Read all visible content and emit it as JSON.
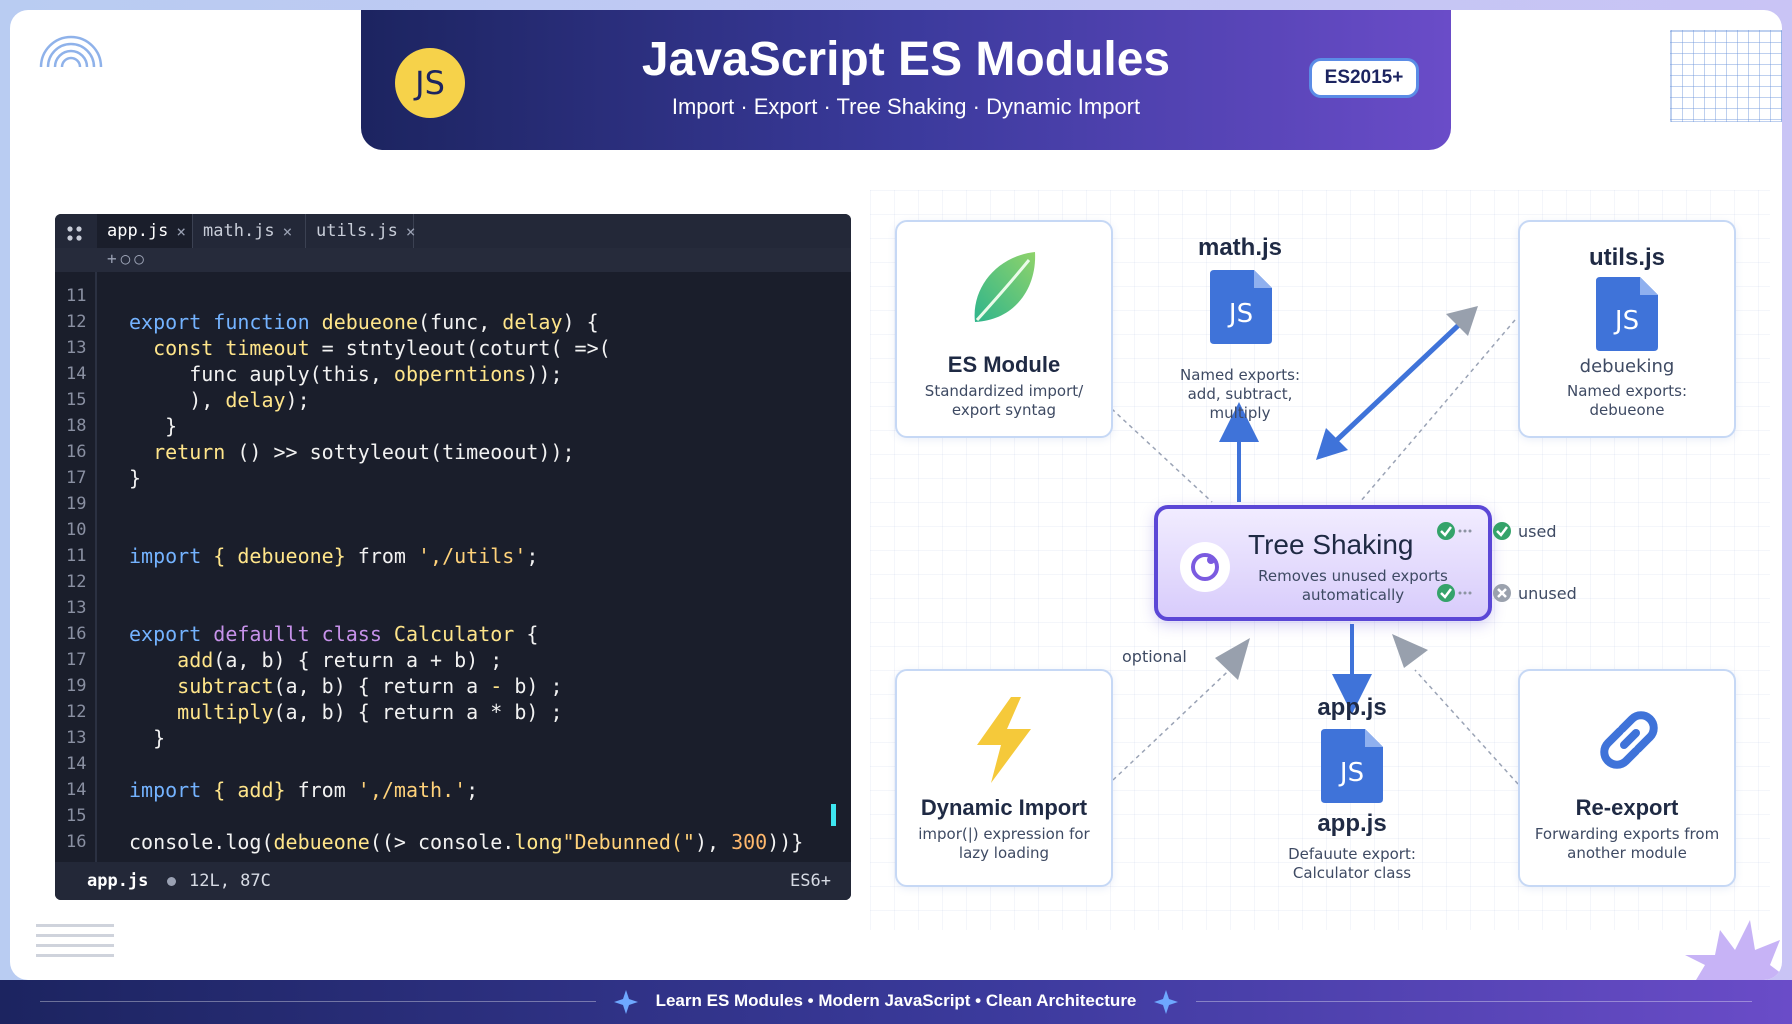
{
  "header": {
    "title": "JavaScript ES Modules",
    "subtitle": "Import · Export · Tree Shaking · Dynamic Import",
    "logo_text": "JS",
    "badge": "ES2015+"
  },
  "editor": {
    "tabs": [
      {
        "label": "app.js",
        "active": true
      },
      {
        "label": "math.js",
        "active": false
      },
      {
        "label": "utils.js",
        "active": false
      }
    ],
    "tab_close": "×",
    "toolbar_icons": "+○○",
    "lines": [
      {
        "n": "11",
        "tokens": []
      },
      {
        "n": "12",
        "tokens": [
          [
            "kw",
            "export "
          ],
          [
            "kw",
            "function "
          ],
          [
            "fn",
            "debueone"
          ],
          [
            "",
            "(func, "
          ],
          [
            "fn",
            "delay"
          ],
          [
            "",
            ") {"
          ]
        ]
      },
      {
        "n": "13",
        "tokens": [
          [
            "",
            "  "
          ],
          [
            "fn",
            "const "
          ],
          [
            "fn",
            "timeout"
          ],
          [
            "",
            " = stntyleout(coturt( =>("
          ]
        ]
      },
      {
        "n": "14",
        "tokens": [
          [
            "",
            "     func auply(this, "
          ],
          [
            "fn",
            "obperntions"
          ],
          [
            "",
            "));"
          ]
        ]
      },
      {
        "n": "15",
        "tokens": [
          [
            "",
            "     ), "
          ],
          [
            "fn",
            "delay"
          ],
          [
            "",
            ");"
          ]
        ]
      },
      {
        "n": "18",
        "tokens": [
          [
            "",
            "   }"
          ]
        ]
      },
      {
        "n": "16",
        "tokens": [
          [
            "",
            "  "
          ],
          [
            "fn",
            "return"
          ],
          [
            "",
            " () >> sottyleout(timeoout));"
          ]
        ]
      },
      {
        "n": "17",
        "tokens": [
          [
            "",
            "}"
          ]
        ]
      },
      {
        "n": "19",
        "tokens": []
      },
      {
        "n": "10",
        "tokens": []
      },
      {
        "n": "11",
        "tokens": [
          [
            "kw",
            "import "
          ],
          [
            "fn",
            "{ debueone}"
          ],
          [
            "",
            " from "
          ],
          [
            "str",
            "',/utils'"
          ],
          [
            "",
            ";"
          ]
        ]
      },
      {
        "n": "12",
        "tokens": []
      },
      {
        "n": "13",
        "tokens": []
      },
      {
        "n": "16",
        "tokens": [
          [
            "kw",
            "export "
          ],
          [
            "kw2",
            "defaullt "
          ],
          [
            "kw2",
            "class "
          ],
          [
            "fn",
            "Calculator"
          ],
          [
            "",
            " {"
          ]
        ]
      },
      {
        "n": "17",
        "tokens": [
          [
            "",
            "    "
          ],
          [
            "fn",
            "add"
          ],
          [
            "",
            "(a, b) { return a + b) ;"
          ]
        ]
      },
      {
        "n": "19",
        "tokens": [
          [
            "",
            "    "
          ],
          [
            "fn",
            "subtract"
          ],
          [
            "",
            "(a, b) { return a "
          ],
          [
            "fn",
            "-"
          ],
          [
            "",
            " b) ;"
          ]
        ]
      },
      {
        "n": "12",
        "tokens": [
          [
            "",
            "    "
          ],
          [
            "fn",
            "multiply"
          ],
          [
            "",
            "(a, b) { return a * b) ;"
          ]
        ]
      },
      {
        "n": "13",
        "tokens": [
          [
            "",
            "  }"
          ]
        ]
      },
      {
        "n": "14",
        "tokens": []
      },
      {
        "n": "14",
        "tokens": [
          [
            "kw",
            "import "
          ],
          [
            "fn",
            "{ add}"
          ],
          [
            "",
            " from "
          ],
          [
            "str",
            "',/math.'"
          ],
          [
            "",
            ";"
          ]
        ]
      },
      {
        "n": "15",
        "tokens": []
      },
      {
        "n": "16",
        "tokens": [
          [
            "",
            "console.log("
          ],
          [
            "fn",
            "debueone"
          ],
          [
            "",
            "((> console."
          ],
          [
            "fn",
            "long"
          ],
          [
            "str",
            "\"Debunned(\""
          ],
          [
            "",
            "), "
          ],
          [
            "num",
            "300"
          ],
          [
            "",
            "))}"
          ]
        ]
      }
    ],
    "status": {
      "file": "app.js",
      "position": "12L, 87C",
      "language": "ES6+"
    }
  },
  "diagram": {
    "es_module": {
      "title": "ES Module",
      "desc": "Standardized import/ export syntag"
    },
    "math": {
      "label": "math.js",
      "desc": "Named exports: add, subtract, multiply"
    },
    "utils": {
      "label": "utils.js",
      "sub": "debueking",
      "desc": "Named exports: debueone"
    },
    "tree": {
      "title": "Tree Shaking",
      "desc": "Removes unused exports automatically"
    },
    "legend": {
      "used": "used",
      "unused": "unused"
    },
    "optional": "optional",
    "dynamic": {
      "title": "Dynamic Import",
      "desc": "impor(|) expression for lazy loading"
    },
    "app": {
      "label_top": "app.js",
      "label_bottom": "app.js",
      "desc": "Defauute export: Calculator class"
    },
    "reexport": {
      "title": "Re-export",
      "desc": "Forwarding exports from another module"
    },
    "file_icon_text": "JS"
  },
  "footer": {
    "text": "Learn ES Modules • Modern JavaScript • Clean Architecture"
  },
  "colors": {
    "accent": "#5b47d6",
    "js_yellow": "#f6d24a",
    "file_blue": "#3f73d9"
  }
}
